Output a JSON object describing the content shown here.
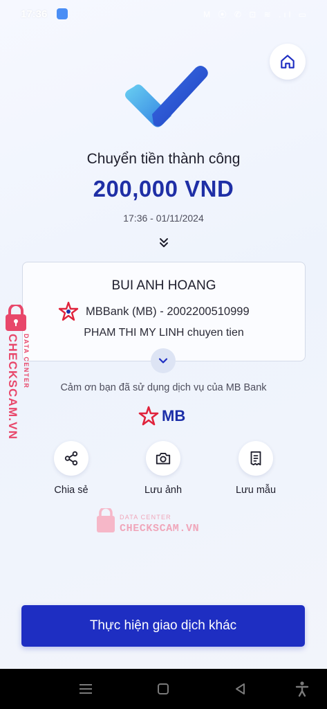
{
  "status_bar": {
    "time": "17:36",
    "icons": "M ⦿ ✆ ⊡ ≋ .ıl ▭"
  },
  "result": {
    "title": "Chuyển tiền thành công",
    "amount": "200,000 VND",
    "datetime": "17:36 - 01/11/2024"
  },
  "transfer": {
    "recipient_name": "BUI ANH HOANG",
    "bank_account": "MBBank (MB) - 2002200510999",
    "memo": "PHAM THI MY LINH chuyen tien"
  },
  "thanks_text": "Cảm ơn bạn đã sử dụng dịch vụ của MB Bank",
  "brand": {
    "logo_text": "MB",
    "primary_color": "#1e2ec2",
    "accent_red": "#e0233c"
  },
  "actions": [
    {
      "label": "Chia sẻ",
      "icon": "share-icon"
    },
    {
      "label": "Lưu ảnh",
      "icon": "camera-icon"
    },
    {
      "label": "Lưu mẫu",
      "icon": "template-icon"
    }
  ],
  "watermark": {
    "line1": "DATA CENTER",
    "line2": "CHECKSCAM.VN"
  },
  "primary_button": "Thực hiện giao dịch khác",
  "navigation": [
    "menu-icon",
    "home-square-icon",
    "back-triangle-icon",
    "accessibility-icon"
  ]
}
